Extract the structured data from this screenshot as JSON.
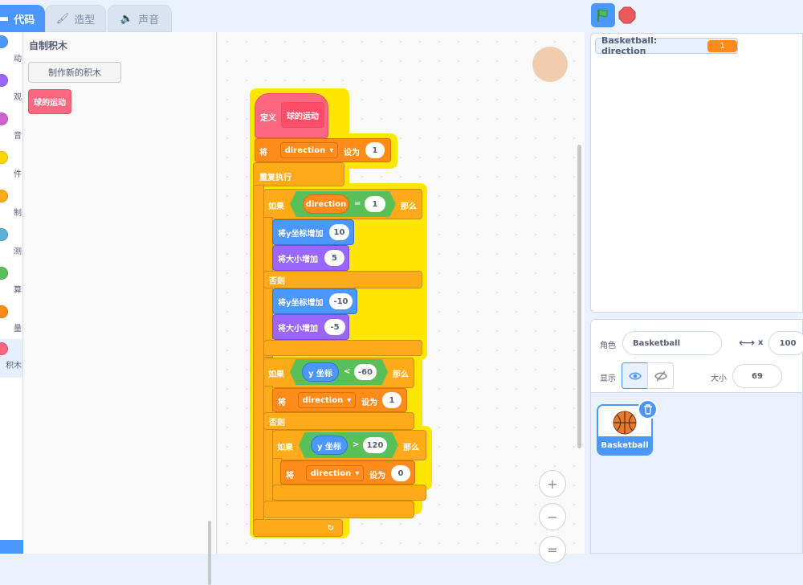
{
  "tabs": {
    "code": "代码",
    "costumes": "造型",
    "sounds": "声音"
  },
  "categories": [
    {
      "label": "动",
      "color": "#4c97ff"
    },
    {
      "label": "观",
      "color": "#9966ff"
    },
    {
      "label": "音",
      "color": "#cf63cf"
    },
    {
      "label": "件",
      "color": "#ffd500"
    },
    {
      "label": "制",
      "color": "#ffab19"
    },
    {
      "label": "测",
      "color": "#5cb1d6"
    },
    {
      "label": "算",
      "color": "#59c059"
    },
    {
      "label": "量",
      "color": "#ff8c1a"
    },
    {
      "label": "积木",
      "color": "#ff6680"
    }
  ],
  "palette": {
    "title": "自制积木",
    "make_block": "制作新的积木",
    "custom_block": "球的运动"
  },
  "script": {
    "define": "定义",
    "define_name": "球的运动",
    "set1": {
      "pre": "将",
      "var": "direction",
      "mid": "设为",
      "val": "1"
    },
    "forever": "重复执行",
    "if1": {
      "pre": "如果",
      "var": "direction",
      "op": "=",
      "val": "1",
      "post": "那么"
    },
    "change_y1": {
      "label": "将y坐标增加",
      "val": "10"
    },
    "change_size1": {
      "label": "将大小增加",
      "val": "5"
    },
    "else1": "否则",
    "change_y2": {
      "label": "将y坐标增加",
      "val": "-10"
    },
    "change_size2": {
      "label": "将大小增加",
      "val": "-5"
    },
    "if2": {
      "pre": "如果",
      "rep": "y 坐标",
      "op": "<",
      "val": "-60",
      "post": "那么"
    },
    "set2": {
      "pre": "将",
      "var": "direction",
      "mid": "设为",
      "val": "1"
    },
    "else2": "否则",
    "if3": {
      "pre": "如果",
      "rep": "y 坐标",
      "op": ">",
      "val": "120",
      "post": "那么"
    },
    "set3": {
      "pre": "将",
      "var": "direction",
      "mid": "设为",
      "val": "0"
    },
    "loop_arrow": "↻"
  },
  "zoom": {
    "in": "+",
    "out": "−",
    "reset": "="
  },
  "stage": {
    "monitor_label": "Basketball: direction",
    "monitor_value": "1"
  },
  "sprite_info": {
    "sprite_label": "角色",
    "sprite_name": "Basketball",
    "x_label": "x",
    "x_value": "100",
    "show_label": "显示",
    "size_label": "大小",
    "size_value": "69"
  },
  "sprites": [
    {
      "name": "Basketball"
    }
  ],
  "colors": {
    "accent": "#4c97ff",
    "variables": "#ff8c1a",
    "control": "#ffab19",
    "my_blocks": "#ff6680",
    "motion": "#4c97ff",
    "looks": "#9966ff",
    "operators": "#59c059"
  }
}
